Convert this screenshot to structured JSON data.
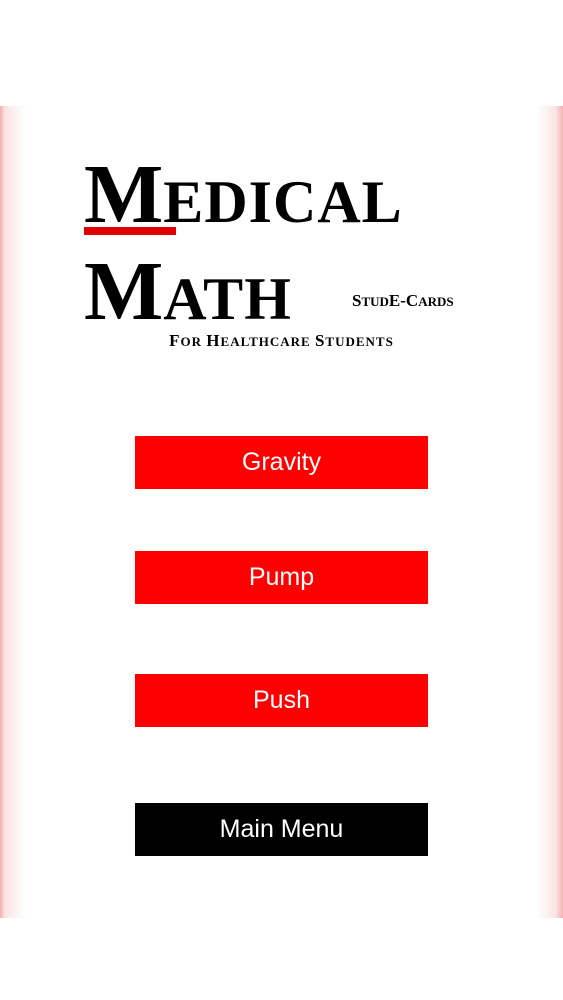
{
  "logo": {
    "line1_initial": "M",
    "line1_rest": "EDICAL",
    "line2_initial": "M",
    "line2_rest": "ATH",
    "edition_s": "S",
    "edition_tud": "TUD",
    "edition_e": "E-C",
    "edition_ards": "ARDS",
    "tagline_parts": [
      "F",
      "OR ",
      "H",
      "EALTHCARE ",
      "S",
      "TUDENTS"
    ],
    "accent_color": "#e00000"
  },
  "menu": {
    "buttons": [
      {
        "label": "Gravity",
        "color": "#ff0000"
      },
      {
        "label": "Pump",
        "color": "#ff0000"
      },
      {
        "label": "Push",
        "color": "#ff0000"
      },
      {
        "label": "Main Menu",
        "color": "#000000"
      }
    ]
  }
}
